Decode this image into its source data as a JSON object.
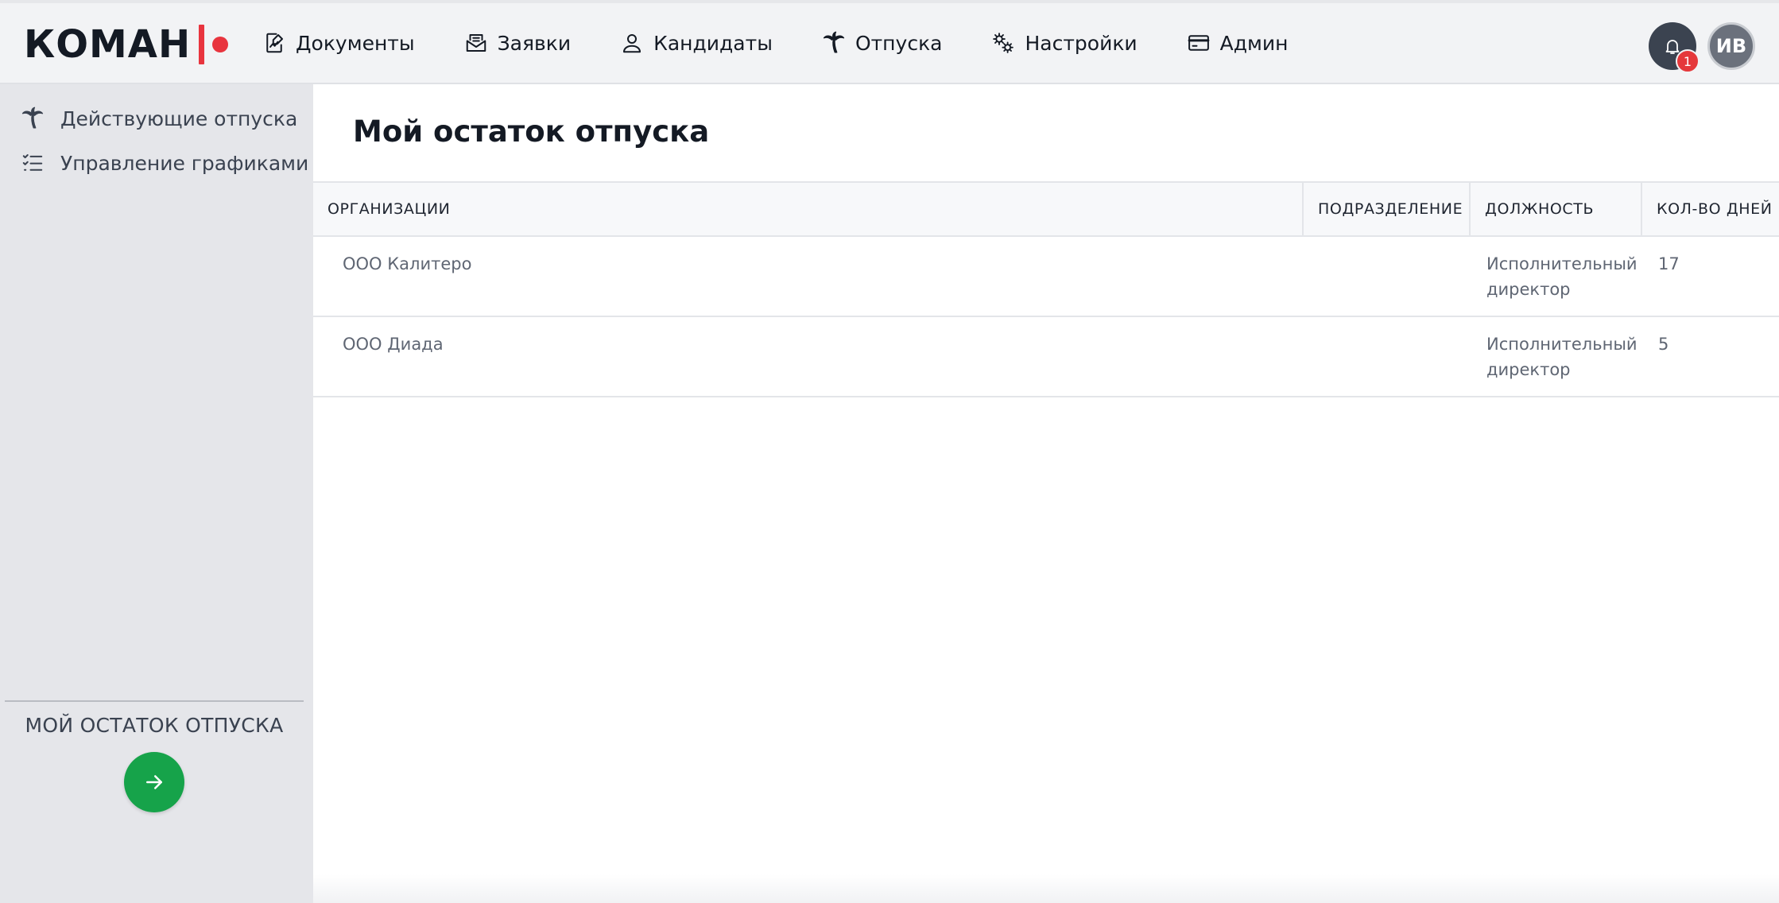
{
  "logo": {
    "text": "КОМАН"
  },
  "nav": {
    "items": [
      {
        "label": "Документы",
        "icon": "document-edit-icon"
      },
      {
        "label": "Заявки",
        "icon": "inbox-envelope-icon"
      },
      {
        "label": "Кандидаты",
        "icon": "person-icon"
      },
      {
        "label": "Отпуска",
        "icon": "palm-tree-icon"
      },
      {
        "label": "Настройки",
        "icon": "gears-icon"
      },
      {
        "label": "Админ",
        "icon": "credit-card-icon"
      }
    ]
  },
  "header": {
    "notifications_count": "1",
    "avatar_initials": "ИВ"
  },
  "sidebar": {
    "items": [
      {
        "label": "Действующие отпуска",
        "icon": "palm-tree-icon"
      },
      {
        "label": "Управление графиками",
        "icon": "checklist-icon"
      }
    ],
    "footer_title": "МОЙ ОСТАТОК ОТПУСКА",
    "footer_button_icon": "arrow-right-icon"
  },
  "main": {
    "title": "Мой остаток отпуска",
    "table": {
      "headers": [
        "ОРГАНИЗАЦИИ",
        "ПОДРАЗДЕЛЕНИЕ",
        "ДОЛЖНОСТЬ",
        "КОЛ-ВО ДНЕЙ"
      ],
      "rows": [
        {
          "organization": "ООО Калитеро",
          "department": "",
          "position": "Исполнительный директор",
          "days": "17"
        },
        {
          "organization": "ООО Диада",
          "department": "",
          "position": "Исполнительный директор",
          "days": "5"
        }
      ]
    }
  },
  "colors": {
    "brand_red": "#e8343e",
    "accent_green": "#16a34a",
    "sidebar_bg": "#e5e6ea",
    "topbar_bg": "#f2f3f5"
  }
}
